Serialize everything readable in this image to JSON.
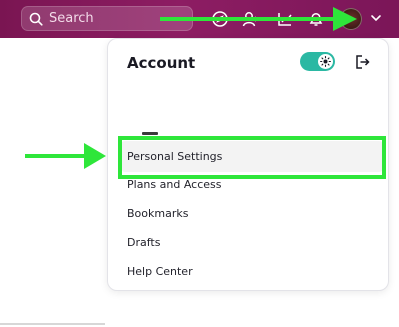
{
  "search": {
    "placeholder": "Search"
  },
  "account_menu": {
    "title": "Account",
    "items": [
      {
        "label": "Personal Settings",
        "active": true
      },
      {
        "label": "Plans and Access"
      },
      {
        "label": "Bookmarks"
      },
      {
        "label": "Drafts"
      },
      {
        "label": "Help Center"
      }
    ]
  },
  "icons": {
    "topbar": [
      "search-icon",
      "compass-icon",
      "user-icon",
      "analytics-icon",
      "bell-icon",
      "chevron-down-icon"
    ],
    "panel": [
      "sun-icon",
      "logout-icon"
    ]
  },
  "colors": {
    "topbar": "#7f185a",
    "toggle": "#2bb8a3",
    "annotation": "#2ee63a",
    "active_item_bg": "#f3f3f3"
  }
}
